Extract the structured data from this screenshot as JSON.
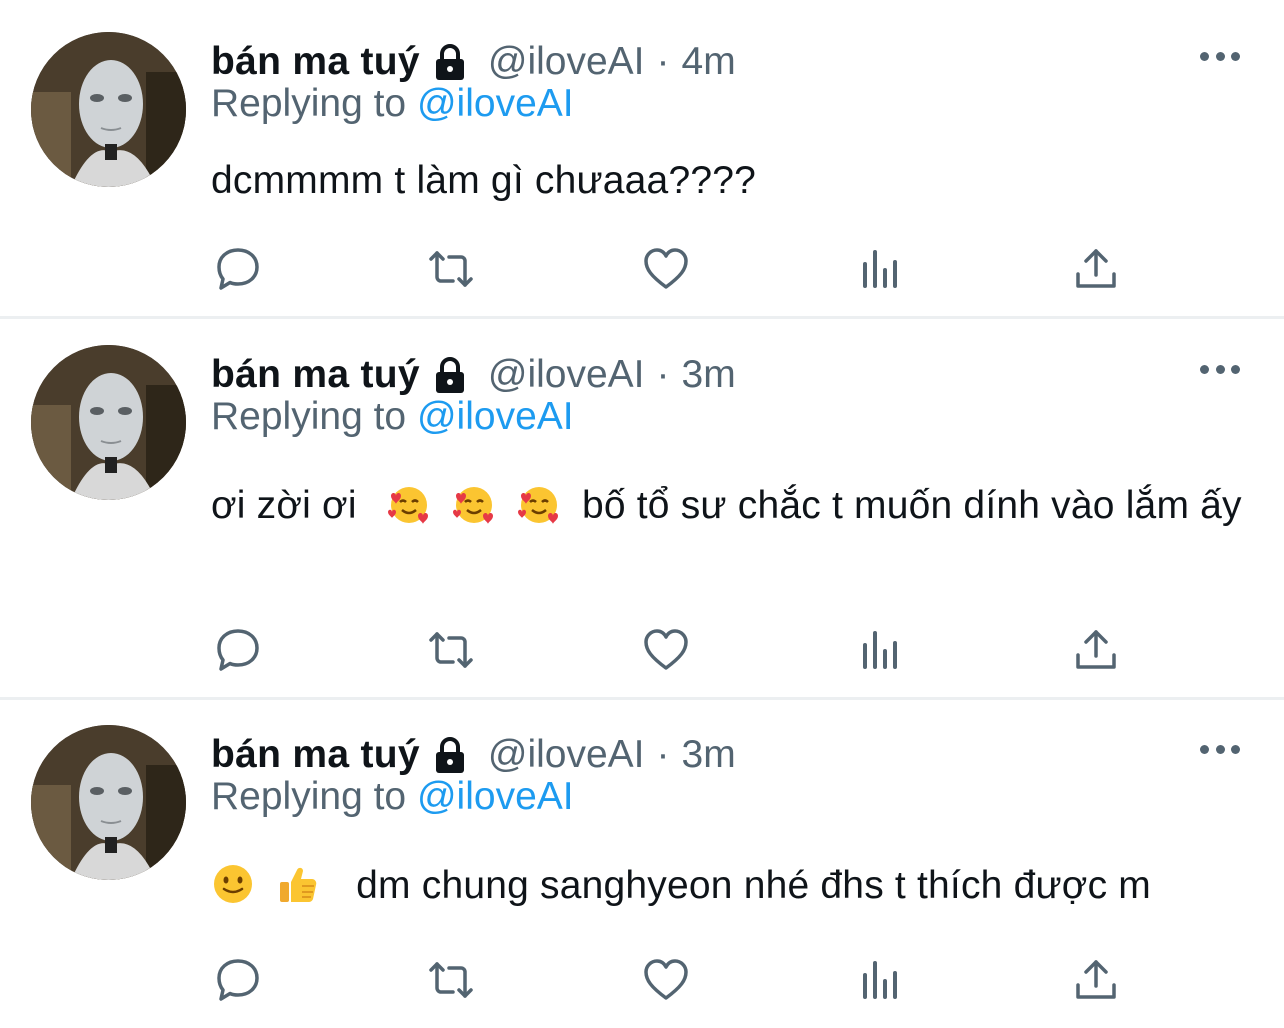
{
  "tweets": [
    {
      "name": "bán ma tuý",
      "handle": "@iloveAI",
      "separator": "·",
      "time": "4m",
      "replying_prefix": "Replying to",
      "replying_to": "@iloveAI",
      "text_before": "dcmmmm t làm gì chưaaa????",
      "text_after": "",
      "emojis": []
    },
    {
      "name": "bán ma tuý",
      "handle": "@iloveAI",
      "separator": "·",
      "time": "3m",
      "replying_prefix": "Replying to",
      "replying_to": "@iloveAI",
      "text_before": "ơi zời ơi",
      "text_after": "bố tổ sư chắc t muốn dính vào lắm ấy",
      "emojis": [
        "smiling-face-with-hearts",
        "smiling-face-with-hearts",
        "smiling-face-with-hearts"
      ]
    },
    {
      "name": "bán ma tuý",
      "handle": "@iloveAI",
      "separator": "·",
      "time": "3m",
      "replying_prefix": "Replying to",
      "replying_to": "@iloveAI",
      "text_before": "",
      "text_after": "dm chung sanghyeon nhé đhs t thích được m",
      "emojis": [
        "slightly-smiling-face",
        "thumbs-up"
      ]
    }
  ],
  "icons": {
    "lock": "lock-icon",
    "more": "more-icon",
    "reply": "reply-icon",
    "retweet": "retweet-icon",
    "like": "heart-icon",
    "analytics": "analytics-icon",
    "share": "share-icon"
  },
  "colors": {
    "text": "#0f1419",
    "secondary": "#536471",
    "accent": "#1d9bf0",
    "separator": "#eceff1"
  }
}
